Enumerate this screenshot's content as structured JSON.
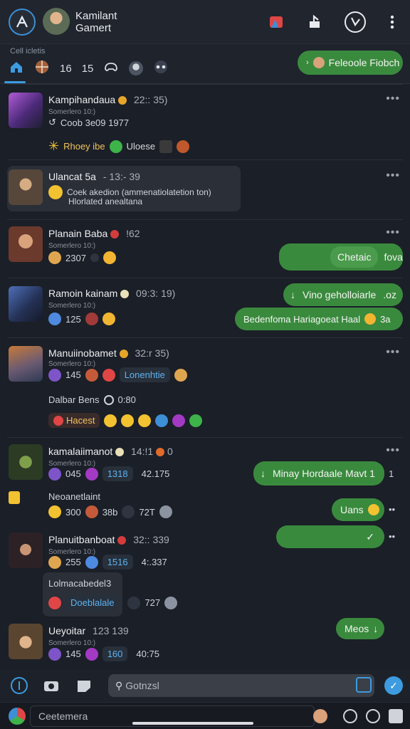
{
  "header": {
    "name": "Kamilant",
    "subtitle": "Gamert",
    "icons": [
      "logo-icon",
      "avatar",
      "video-call-icon",
      "share-icon",
      "call-icon",
      "more-vertical-icon"
    ]
  },
  "filters": {
    "title": "Cell icletis",
    "items": [
      {
        "icon": "home-icon",
        "label": ""
      },
      {
        "icon": "globe-icon",
        "label": ""
      },
      {
        "icon": "",
        "label": "16"
      },
      {
        "icon": "",
        "label": "15"
      },
      {
        "icon": "gamepad-icon",
        "label": ""
      },
      {
        "icon": "avatar",
        "label": ""
      },
      {
        "icon": "controller-icon",
        "label": ""
      }
    ],
    "top_pill": "Feleoole Fiobch"
  },
  "chats": [
    {
      "name": "Kampihandaua",
      "time": "22:: 35)",
      "sub": "Somerlero 10:)",
      "line": "Coob 3e09 1977",
      "reactions_label_1": "Rhoey ibe",
      "reactions_label_2": "Uloese"
    },
    {
      "name": "Ulancat 5a",
      "time": "- 13:- 39",
      "msg_1": "Coek akedion (ammenatiolatetion ton)",
      "msg_2": "Hlorlated anealtana"
    },
    {
      "name": "Planain Baba",
      "time": "!62",
      "sub": "Somerlero 10:)",
      "line": "2307",
      "green": "Chetaic",
      "green_suffix": "fova"
    },
    {
      "name": "Ramoin kainam",
      "time": "09:3: 19)",
      "sub": "Somerlero 10:)",
      "line": "125",
      "green_1": "Vino geholloiarle",
      "green_1_suffix": ".oz",
      "green_2": "Bedenfoma Hariagoeat Haal",
      "green_2_suffix": "3a"
    },
    {
      "name": "Manuiinobamet",
      "time": "32:r 35)",
      "sub": "Somerlero 10:)",
      "line": "145",
      "chip": "Lonenhtie",
      "sub_2": "Dalbar Bens",
      "sub_2_time": "0:80",
      "chip_2": "Hacest"
    },
    {
      "name": "kamalaiimanot",
      "time": "14:!1",
      "time_2": "0",
      "sub": "Somerlero 10:)",
      "line": "045",
      "chip": "1318",
      "line_num": "42.175",
      "green": "Minay Hordaale Mavt 1",
      "green_suffix": "1",
      "sub_2": "Neoanetlaint",
      "line_2": "300",
      "line_2b": "38b",
      "line_2c": "72T",
      "green_2": "Uans"
    },
    {
      "name": "Planuitbanboat",
      "time": "32:: 339",
      "sub": "Somerlero 10:)",
      "line": "255",
      "chip": "1516",
      "line_num": "4:.337",
      "msg": "Lolmacabedel3",
      "chip_2": "Doeblalale",
      "line_num_2": "727",
      "green": ""
    },
    {
      "name": "Ueyoitar",
      "time": "123 139",
      "sub": "Somerlero 10:)",
      "line": "145",
      "chip": "160",
      "line_num": "40:75",
      "green": "Meos"
    }
  ],
  "composer": {
    "placeholder": "Gotnzsl"
  },
  "bottombar": {
    "label": "Ceetemera"
  }
}
